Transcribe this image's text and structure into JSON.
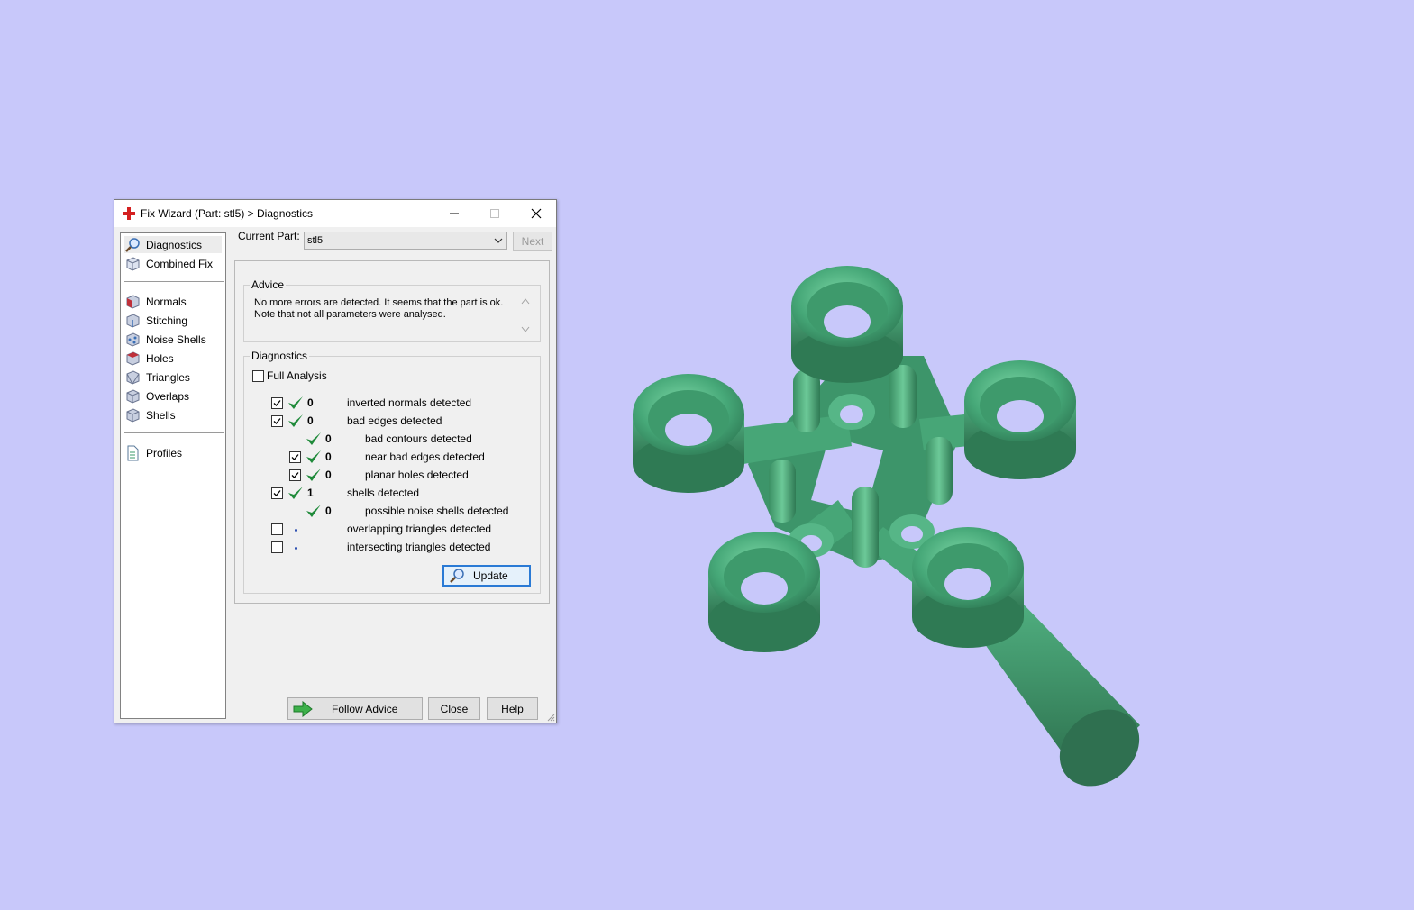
{
  "window": {
    "title": "Fix Wizard (Part: stl5) > Diagnostics",
    "icon": "red-cross-icon"
  },
  "sidebar": {
    "items": [
      {
        "label": "Diagnostics",
        "icon": "magnifier-icon",
        "selected": true
      },
      {
        "label": "Combined Fix",
        "icon": "cube-icon"
      },
      {
        "label": "Normals",
        "icon": "normals-cube-icon"
      },
      {
        "label": "Stitching",
        "icon": "stitching-cube-icon"
      },
      {
        "label": "Noise Shells",
        "icon": "noise-shells-icon"
      },
      {
        "label": "Holes",
        "icon": "holes-cube-icon"
      },
      {
        "label": "Triangles",
        "icon": "triangles-cube-icon"
      },
      {
        "label": "Overlaps",
        "icon": "overlaps-cube-icon"
      },
      {
        "label": "Shells",
        "icon": "shells-cube-icon"
      },
      {
        "label": "Profiles",
        "icon": "profile-document-icon"
      }
    ]
  },
  "current_part": {
    "label": "Current Part:",
    "value": "stl5",
    "next_label": "Next"
  },
  "advice": {
    "title": "Advice",
    "line1": "No more errors are detected. It seems that the part is ok.",
    "line2": "Note that not all parameters were analysed."
  },
  "diagnostics": {
    "title": "Diagnostics",
    "full_analysis_label": "Full Analysis",
    "full_analysis_checked": false,
    "rows": [
      {
        "checkbox": true,
        "checked": true,
        "status": "check",
        "count": "0",
        "label": "inverted normals detected"
      },
      {
        "checkbox": true,
        "checked": true,
        "status": "check",
        "count": "0",
        "label": "bad edges detected"
      },
      {
        "checkbox": false,
        "status": "check",
        "count": "0",
        "label": "bad contours detected"
      },
      {
        "checkbox": true,
        "checked": true,
        "status": "check",
        "count": "0",
        "label": "near bad edges detected"
      },
      {
        "checkbox": true,
        "checked": true,
        "status": "check",
        "count": "0",
        "label": "planar holes detected"
      },
      {
        "checkbox": true,
        "checked": true,
        "status": "check",
        "count": "1",
        "label": "shells detected"
      },
      {
        "checkbox": false,
        "status": "check",
        "count": "0",
        "label": "possible noise shells detected"
      },
      {
        "checkbox": true,
        "checked": false,
        "status": "dot",
        "count": "",
        "label": "overlapping triangles detected"
      },
      {
        "checkbox": true,
        "checked": false,
        "status": "dot",
        "count": "",
        "label": "intersecting triangles detected"
      }
    ],
    "update_label": "Update"
  },
  "footer": {
    "follow_advice_label": "Follow Advice",
    "close_label": "Close",
    "help_label": "Help"
  },
  "colors": {
    "viewport_background": "#c8c8fa",
    "model_green": "#3f9e6e",
    "check_green": "#1f8a3a",
    "focus_blue": "#2a7ad5"
  }
}
